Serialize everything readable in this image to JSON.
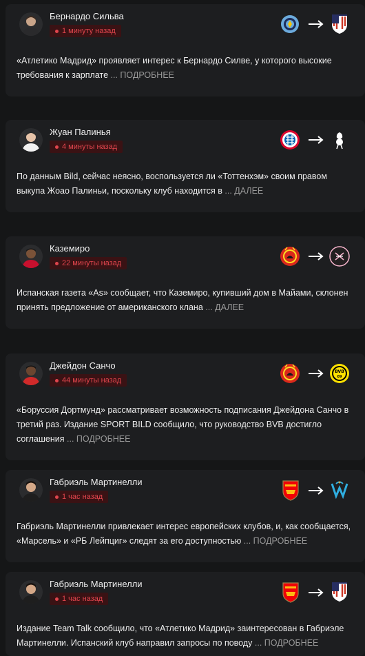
{
  "colors": {
    "background": "#151617",
    "card": "#1d1e20",
    "badge_bg": "#3a1214",
    "badge_text": "#e0454d",
    "more_text": "#9a9a9a"
  },
  "transfers": [
    {
      "player": "Бернардо Сильва",
      "time": "1 минуту назад",
      "from_icon": "manchester-city-crest-icon",
      "to_icon": "atletico-madrid-crest-icon",
      "text": "«Атлетико Мадрид» проявляет интерес к Бернардо Силве, у которого высокие требования к зарплате",
      "more": "... ПОДРОБНЕЕ"
    },
    {
      "player": "Жуан Палинья",
      "time": "4 минуты назад",
      "from_icon": "bayern-munich-crest-icon",
      "to_icon": "tottenham-crest-icon",
      "text": "По данным Bild, сейчас неясно, воспользуется ли «Тоттенхэм» своим правом выкупа Жоао Палиньи, поскольку клуб находится в",
      "more": "... ДАЛЕЕ"
    },
    {
      "player": "Каземиро",
      "time": "22 минуты назад",
      "from_icon": "manchester-united-crest-icon",
      "to_icon": "inter-miami-crest-icon",
      "text": "Испанская газета «As» сообщает, что Каземиро, купивший дом в Майами, склонен принять предложение от американского клана",
      "more": "... ДАЛЕЕ"
    },
    {
      "player": "Джейдон Санчо",
      "time": "44 минуты назад",
      "from_icon": "manchester-united-crest-icon",
      "to_icon": "borussia-dortmund-crest-icon",
      "text": "«Боруссия Дортмунд» рассматривает возможность подписания Джейдона Санчо в третий раз. Издание SPORT BILD сообщило, что руководство BVB достигло соглашения",
      "more": "... ПОДРОБНЕЕ"
    },
    {
      "player": "Габриэль Мартинелли",
      "time": "1 час назад",
      "from_icon": "arsenal-crest-icon",
      "to_icon": "marseille-crest-icon",
      "text": "Габриэль Мартинелли привлекает интерес европейских клубов, и, как сообщается, «Марсель» и «РБ Лейпциг» следят за его доступностью",
      "more": "... ПОДРОБНЕЕ"
    },
    {
      "player": "Габриэль Мартинелли",
      "time": "1 час назад",
      "from_icon": "arsenal-crest-icon",
      "to_icon": "atletico-madrid-crest-icon",
      "text": "Издание Team Talk сообщило, что «Атлетико Мадрид» заинтересован в Габриэле Мартинелли. Испанский клуб направил запросы по поводу",
      "more": "... ПОДРОБНЕЕ"
    }
  ]
}
